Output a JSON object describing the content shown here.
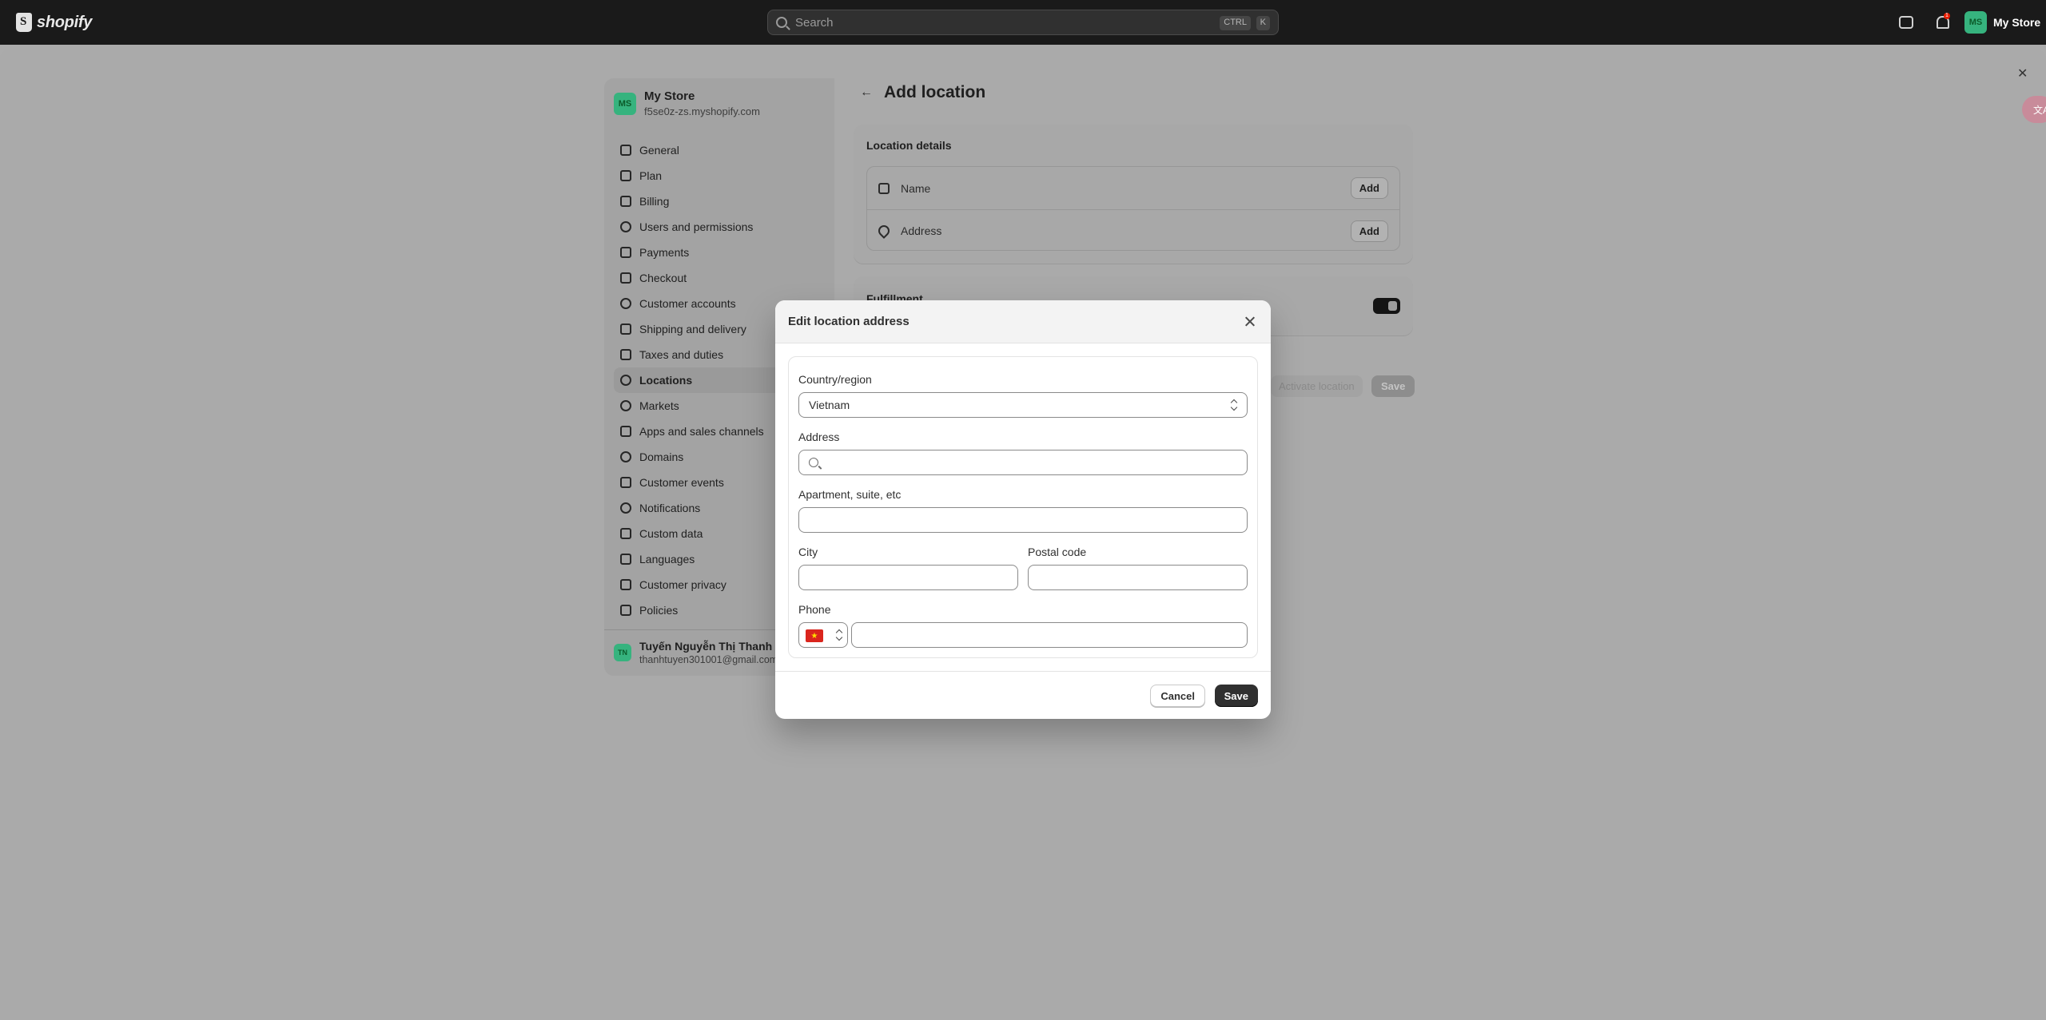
{
  "topbar": {
    "logo_text": "shopify",
    "search_placeholder": "Search",
    "kbd_ctrl": "CTRL",
    "kbd_k": "K",
    "notification_count": "1",
    "store_initials": "MS",
    "store_name": "My Store"
  },
  "sidebar": {
    "store_initials": "MS",
    "store_name": "My Store",
    "store_url": "f5se0z-zs.myshopify.com",
    "items": [
      {
        "label": "General",
        "icon": "store-icon"
      },
      {
        "label": "Plan",
        "icon": "chart-icon"
      },
      {
        "label": "Billing",
        "icon": "billing-icon"
      },
      {
        "label": "Users and permissions",
        "icon": "users-icon"
      },
      {
        "label": "Payments",
        "icon": "payments-icon"
      },
      {
        "label": "Checkout",
        "icon": "cart-icon"
      },
      {
        "label": "Customer accounts",
        "icon": "person-icon"
      },
      {
        "label": "Shipping and delivery",
        "icon": "truck-icon"
      },
      {
        "label": "Taxes and duties",
        "icon": "taxes-icon"
      },
      {
        "label": "Locations",
        "icon": "location-icon"
      },
      {
        "label": "Markets",
        "icon": "globe-icon"
      },
      {
        "label": "Apps and sales channels",
        "icon": "apps-icon"
      },
      {
        "label": "Domains",
        "icon": "domain-icon"
      },
      {
        "label": "Customer events",
        "icon": "events-icon"
      },
      {
        "label": "Notifications",
        "icon": "bell-icon"
      },
      {
        "label": "Custom data",
        "icon": "data-icon"
      },
      {
        "label": "Languages",
        "icon": "language-icon"
      },
      {
        "label": "Customer privacy",
        "icon": "lock-icon"
      },
      {
        "label": "Policies",
        "icon": "policy-icon"
      }
    ],
    "active_item": "Locations",
    "account_initials": "TN",
    "account_name": "Tuyến Nguyễn Thị Thanh",
    "account_email": "thanhtuyen301001@gmail.com"
  },
  "main": {
    "title": "Add location",
    "details_title": "Location details",
    "name_label": "Name",
    "address_label": "Address",
    "add_label": "Add",
    "fulfillment_title": "Fulfillment",
    "activate_label": "Activate location",
    "save_label": "Save"
  },
  "modal": {
    "title": "Edit location address",
    "country_label": "Country/region",
    "country_value": "Vietnam",
    "address_label": "Address",
    "address_value": "",
    "apartment_label": "Apartment, suite, etc",
    "city_label": "City",
    "postal_label": "Postal code",
    "phone_label": "Phone",
    "phone_flag": "★",
    "cancel_label": "Cancel",
    "save_label": "Save"
  },
  "colors": {
    "topbar": "#1a1a1a",
    "overlay": "#aaaaaa",
    "primary_button": "#303030",
    "avatar": "#36b37e"
  }
}
